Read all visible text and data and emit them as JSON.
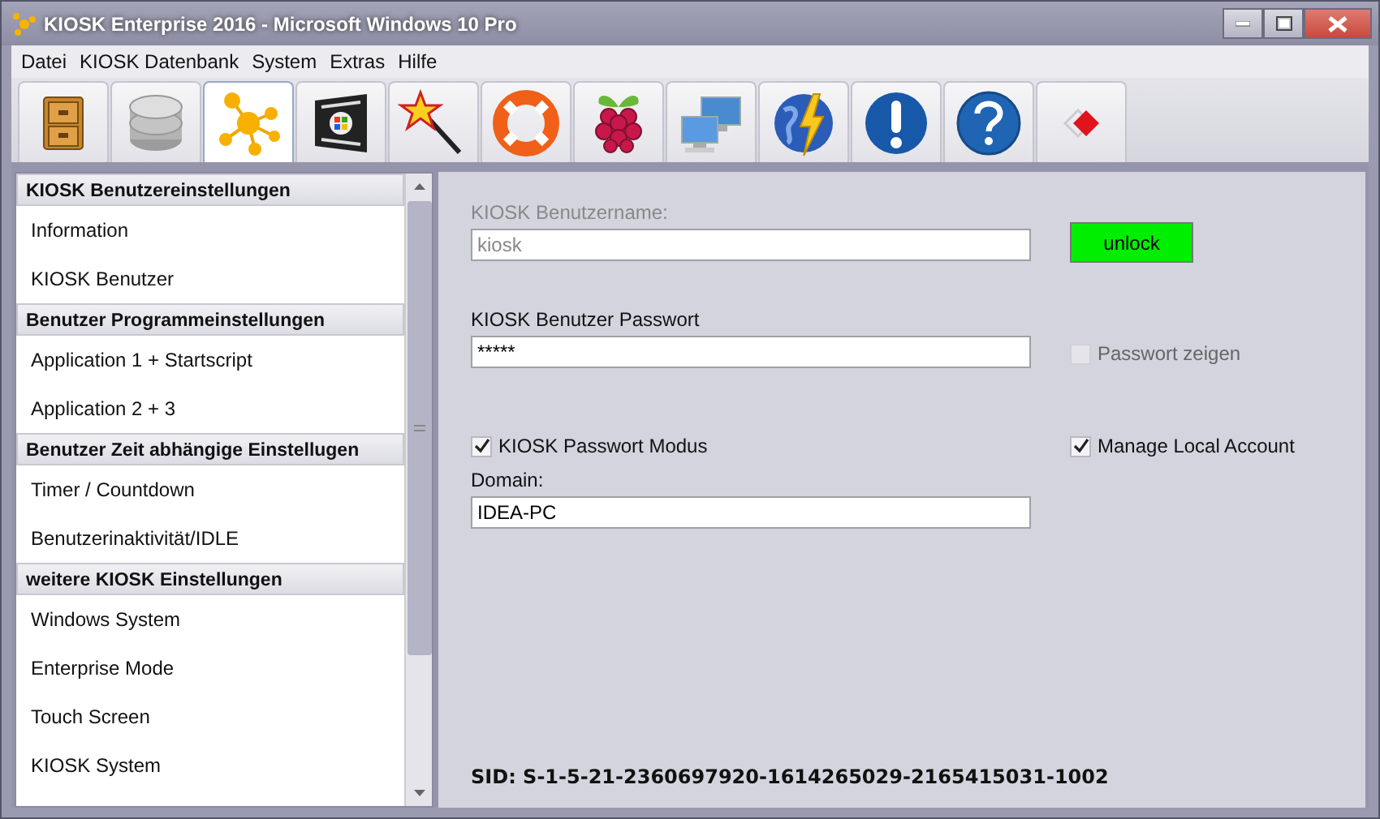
{
  "window": {
    "title": "KIOSK Enterprise 2016 - Microsoft Windows 10 Pro"
  },
  "menu": [
    "Datei",
    "KIOSK Datenbank",
    "System",
    "Extras",
    "Hilfe"
  ],
  "toolbar": [
    {
      "kind": "cabinet",
      "selected": false
    },
    {
      "kind": "database",
      "selected": false
    },
    {
      "kind": "molecule",
      "selected": true
    },
    {
      "kind": "windows",
      "selected": false
    },
    {
      "kind": "wand",
      "selected": false
    },
    {
      "kind": "lifebuoy",
      "selected": false
    },
    {
      "kind": "raspberry",
      "selected": false
    },
    {
      "kind": "network",
      "selected": false
    },
    {
      "kind": "globe",
      "selected": false
    },
    {
      "kind": "info",
      "selected": false
    },
    {
      "kind": "help",
      "selected": false
    },
    {
      "kind": "tag",
      "selected": false
    }
  ],
  "sidebar": {
    "groups": [
      {
        "title": "KIOSK Benutzereinstellungen",
        "items": [
          "Information",
          "KIOSK Benutzer"
        ]
      },
      {
        "title": "Benutzer Programmeinstellungen",
        "items": [
          "Application 1 + Startscript",
          "Application 2 + 3"
        ]
      },
      {
        "title": "Benutzer Zeit abhängige Einstellugen",
        "items": [
          "Timer / Countdown",
          "Benutzerinaktivität/IDLE"
        ]
      },
      {
        "title": "weitere KIOSK Einstellungen",
        "items": [
          "Windows System",
          "Enterprise Mode",
          "Touch Screen",
          "KIOSK System"
        ]
      }
    ]
  },
  "form": {
    "username": {
      "label": "KIOSK Benutzername:",
      "value": "kiosk",
      "disabled": true
    },
    "unlock_button": "unlock",
    "password": {
      "label": "KIOSK Benutzer Passwort",
      "value": "*****"
    },
    "show_password": {
      "label": "Passwort zeigen",
      "checked": false,
      "disabled": true
    },
    "password_mode": {
      "label": "KIOSK Passwort Modus",
      "checked": true,
      "disabled": false
    },
    "manage_local_account": {
      "label": "Manage Local Account",
      "checked": true,
      "disabled": false
    },
    "domain": {
      "label": "Domain:",
      "value": "IDEA-PC"
    },
    "sid": "SID:  S-1-5-21-2360697920-1614265029-2165415031-1002"
  }
}
